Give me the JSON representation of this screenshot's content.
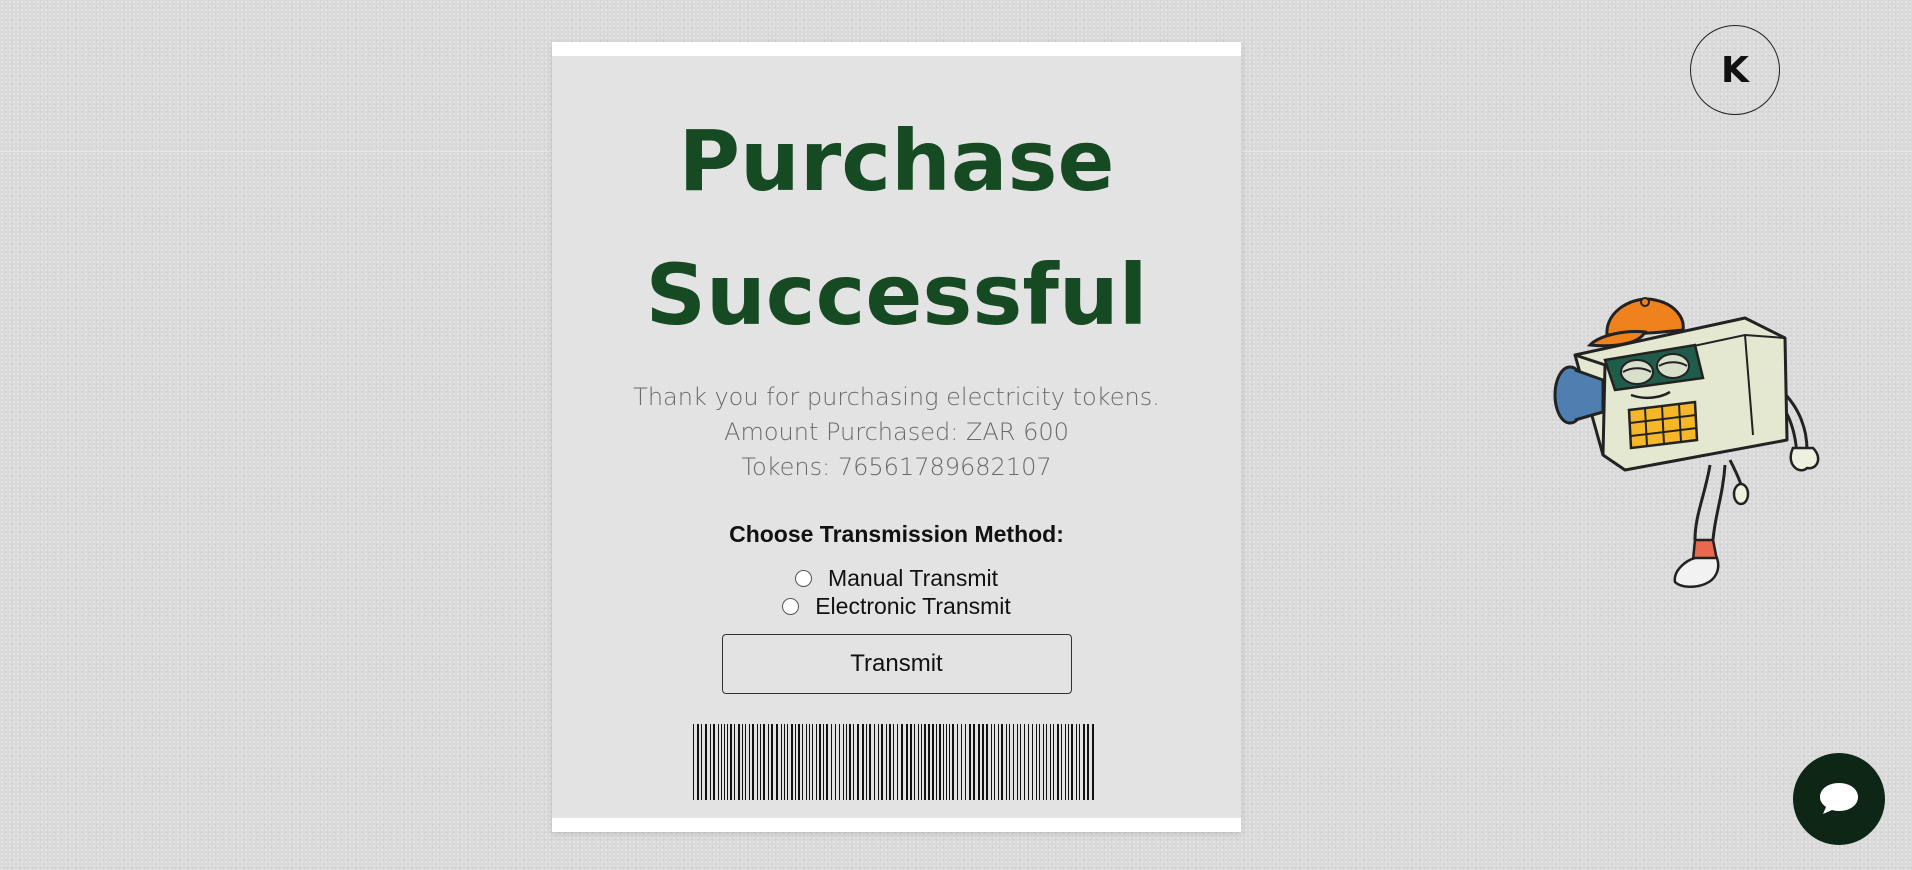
{
  "header": {
    "logo_letter": "K"
  },
  "receipt": {
    "title_line1": "Purchase",
    "title_line2": "Successful",
    "thank_you": "Thank you for purchasing electricity tokens.",
    "amount_line": "Amount Purchased: ZAR 600",
    "tokens_line": "Tokens: 76561789682107",
    "method_heading": "Choose Transmission Method:",
    "options": [
      {
        "label": "Manual Transmit",
        "selected": false
      },
      {
        "label": "Electronic Transmit",
        "selected": false
      }
    ],
    "transmit_label": "Transmit"
  },
  "icons": {
    "chat": "chat-bubble-icon",
    "mascot": "meter-mascot-illustration",
    "barcode": "barcode-icon"
  },
  "colors": {
    "title_green": "#154a22",
    "chat_button_bg": "#0e2616",
    "page_bg": "#d9d9d9",
    "receipt_bg": "#e3e3e3"
  }
}
